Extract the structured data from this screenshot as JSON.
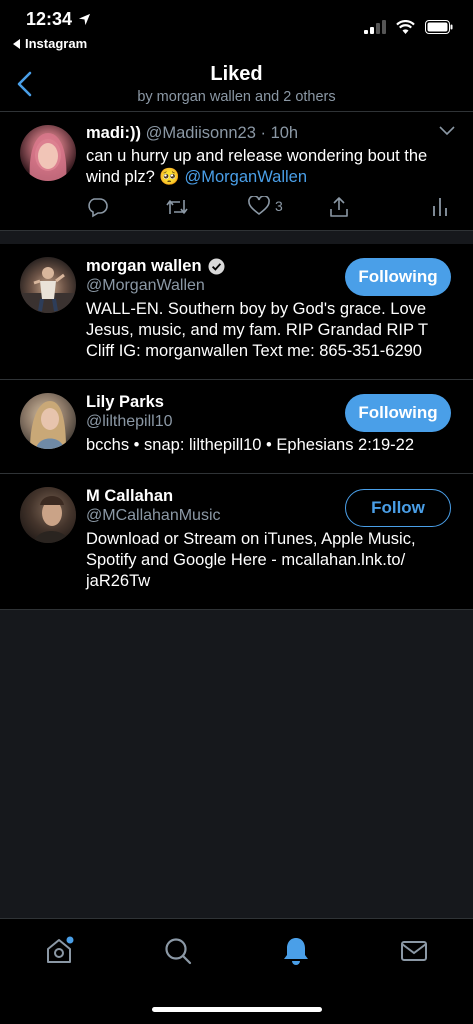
{
  "status_bar": {
    "time": "12:34",
    "back_app": "Instagram"
  },
  "nav": {
    "title": "Liked",
    "subtitle": "by morgan wallen and 2 others"
  },
  "tweet": {
    "name": "madi:))",
    "handle": "@Madiisonn23",
    "time": "10h",
    "text": "can u hurry up and release wondering bout the wind plz? 🥺 ",
    "mention": "@MorganWallen",
    "like_count": "3"
  },
  "users": [
    {
      "name": "morgan wallen",
      "verified": true,
      "handle": "@MorganWallen",
      "bio": "WALL-EN. Southern boy by God's grace. Love Jesus, music, and my fam. RIP Grandad RIP T Cliff IG: morganwallen Text me: 865-351-6290",
      "button": "Following"
    },
    {
      "name": "Lily Parks",
      "handle": "@lilthepill10",
      "bio": "bcchs • snap: lilthepill10 • Ephesians 2:19-22",
      "button": "Following"
    },
    {
      "name": "M Callahan",
      "handle": "@MCallahanMusic",
      "bio": "Download or Stream on iTunes, Apple Music, Spotify and Google Here - mcallahan.lnk.to/ jaR26Tw",
      "button": "Follow"
    }
  ],
  "colors": {
    "accent": "#4a9fe8",
    "background": "#000000",
    "secondary_text": "#8b98a5"
  },
  "tabs": [
    "home-icon",
    "search-icon",
    "notifications-icon",
    "messages-icon"
  ]
}
